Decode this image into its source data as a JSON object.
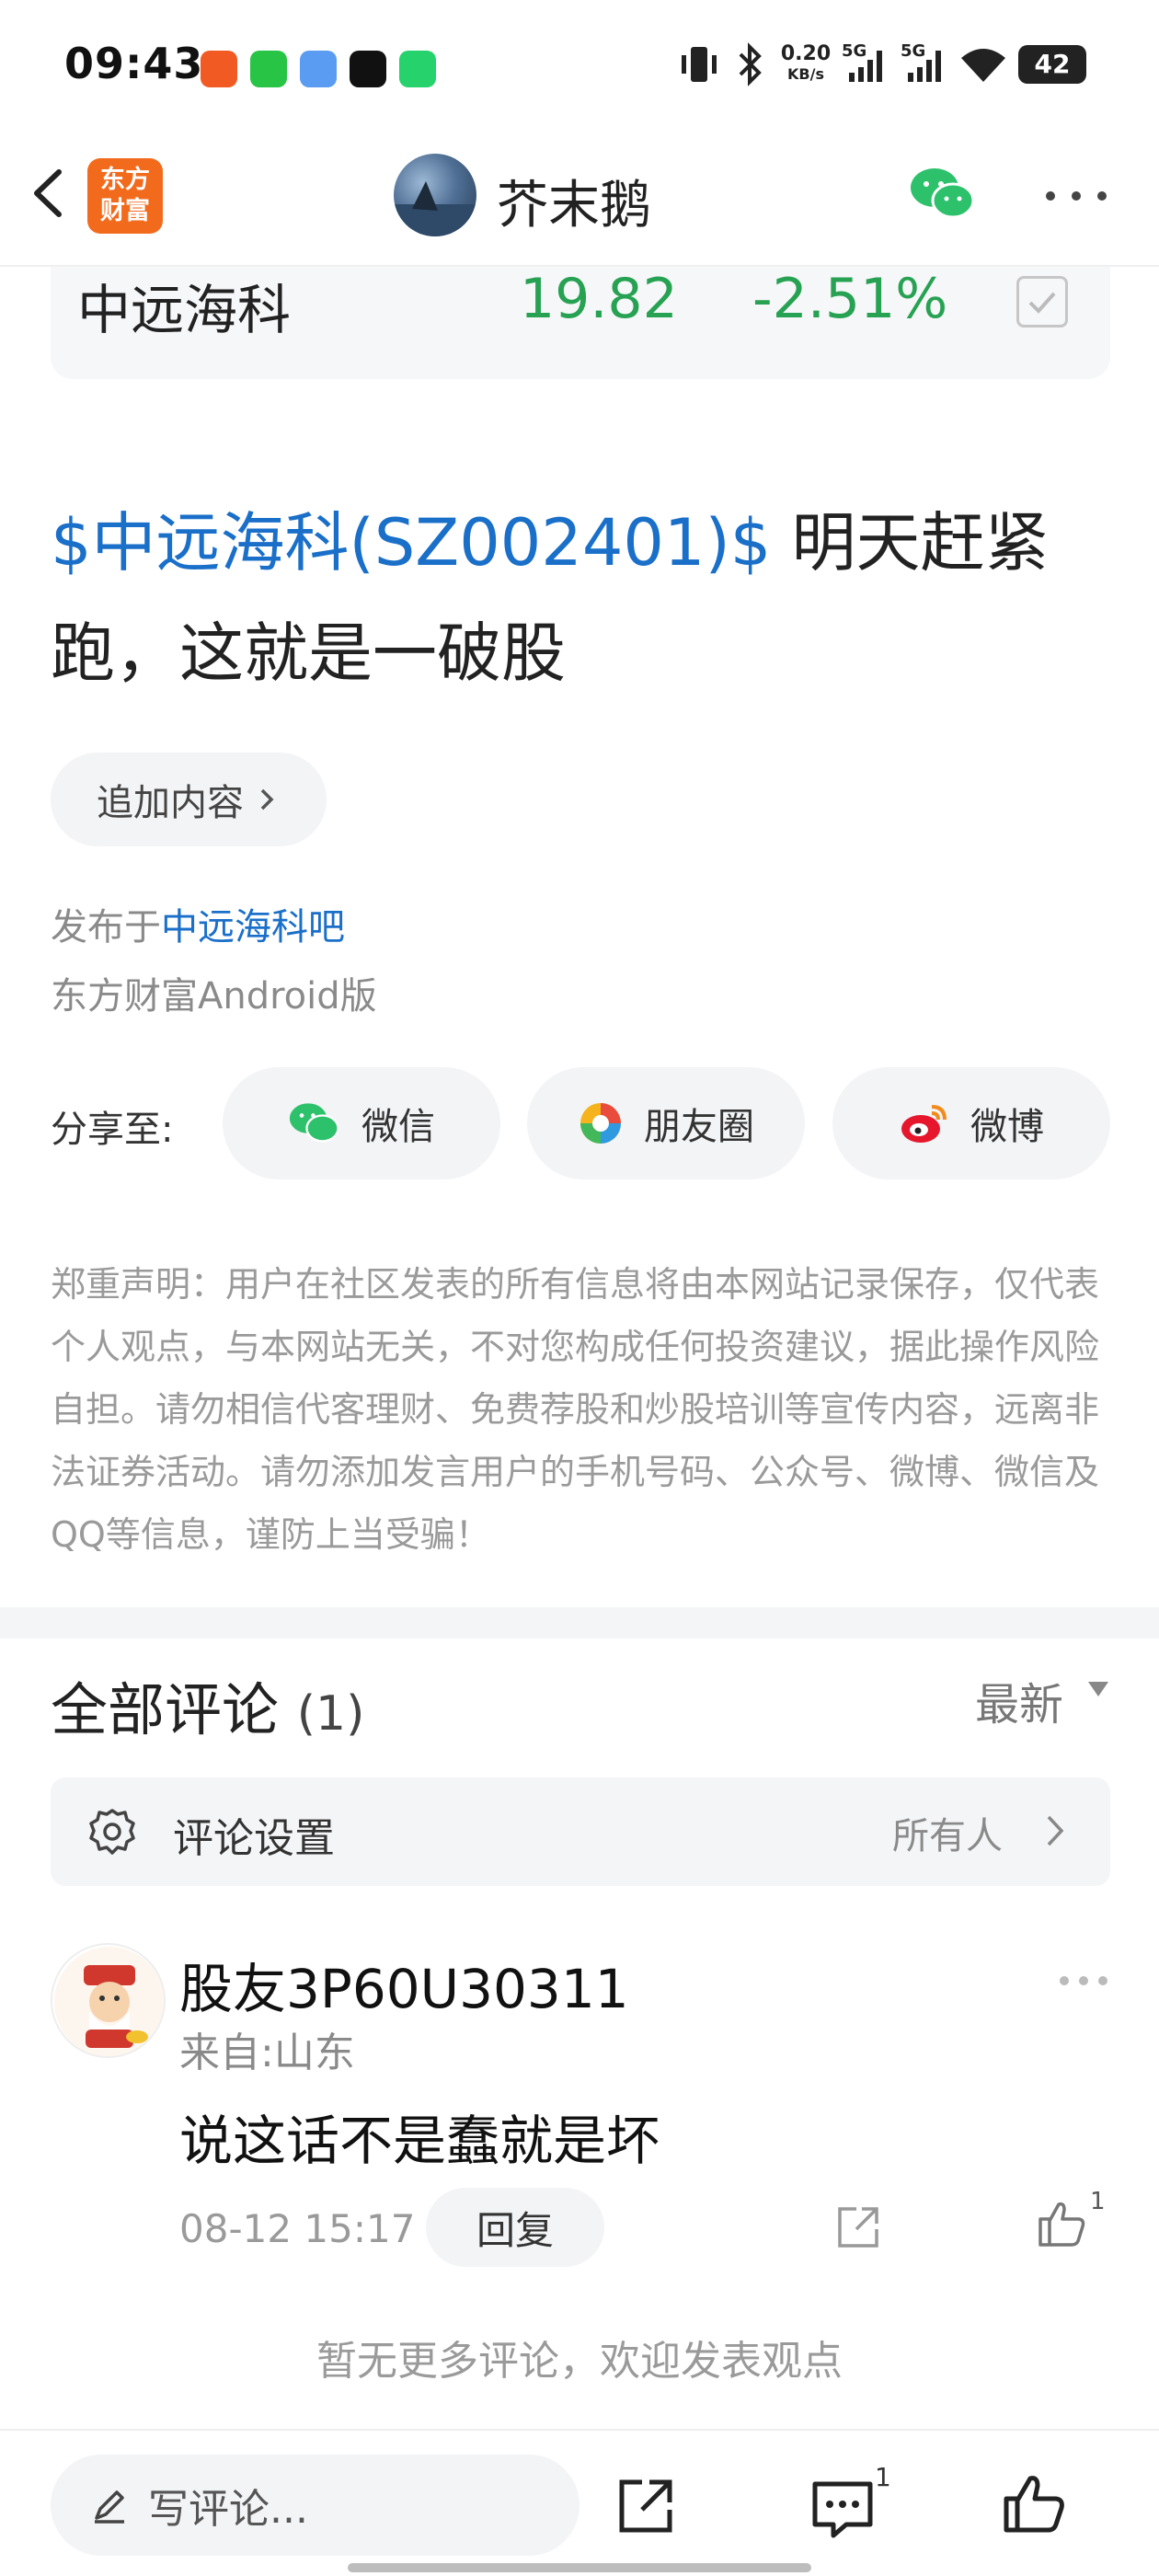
{
  "status_bar": {
    "time": "09:43",
    "net_speed_value": "0.20",
    "net_speed_unit": "KB/s",
    "signal1": "5G",
    "signal2": "5G",
    "battery": "42"
  },
  "header": {
    "logo_line1": "东方",
    "logo_line2": "财富",
    "username": "芥末鹅"
  },
  "quote": {
    "name": "中远海科",
    "price": "19.82",
    "change": "-2.51%",
    "color_down": "#27a253"
  },
  "post": {
    "stock_tag": "$中远海科(SZ002401)$",
    "text": " 明天赶紧跑，这就是一破股",
    "append_label": "追加内容",
    "published_prefix": "发布于",
    "bar_name": "中远海科吧",
    "client": "东方财富Android版"
  },
  "share": {
    "label": "分享至:",
    "options": [
      {
        "label": "微信",
        "icon": "wechat-icon"
      },
      {
        "label": "朋友圈",
        "icon": "moments-icon"
      },
      {
        "label": "微博",
        "icon": "weibo-icon"
      }
    ]
  },
  "disclaimer": "郑重声明：用户在社区发表的所有信息将由本网站记录保存，仅代表个人观点，与本网站无关，不对您构成任何投资建议，据此操作风险自担。请勿相信代客理财、免费荐股和炒股培训等宣传内容，远离非法证券活动。请勿添加发言用户的手机号码、公众号、微博、微信及QQ等信息，谨防上当受骗！",
  "comments": {
    "title": "全部评论",
    "count": "(1)",
    "sort": "最新",
    "settings_label": "评论设置",
    "settings_value": "所有人",
    "items": [
      {
        "user": "股友3P60U30311",
        "location": "来自:山东",
        "text": "说这话不是蠢就是坏",
        "time": "08-12 15:17",
        "reply_label": "回复",
        "likes": "1"
      }
    ],
    "no_more": "暂无更多评论，欢迎发表观点"
  },
  "bottom_bar": {
    "placeholder": "写评论...",
    "comment_count": "1"
  },
  "colors": {
    "link": "#1a6fc9",
    "brand": "#f26b1d"
  }
}
